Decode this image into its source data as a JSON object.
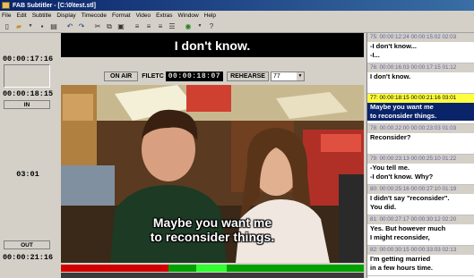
{
  "window": {
    "title": "FAB Subtitler - [C:\\0\\test.stl]"
  },
  "menu": [
    "File",
    "Edit",
    "Subtitle",
    "Display",
    "Timecode",
    "Format",
    "Video",
    "Extras",
    "Window",
    "Help"
  ],
  "left_panel": {
    "tc_in": "00:00:17:16",
    "tc_out_top": "00:00:18:15",
    "in_label": "IN",
    "duration": "03:01",
    "out_label": "OUT",
    "tc_out_bottom": "00:00:21:16"
  },
  "top_subtitle": "I don't know.",
  "controls": {
    "on_air": "ON AIR",
    "filetc_label": "FILETC",
    "filetc_value": "00:00:18:07",
    "rehearse": "REHEARSE",
    "subtitle_number": "77"
  },
  "video": {
    "subtitle_line1": "Maybe you want me",
    "subtitle_line2": "to reconsider things.",
    "progress_fraction": 0.52
  },
  "subtitle_list": [
    {
      "header": "75: 00:00:12:24  00:00:15:02  02:03",
      "lines": [
        "-I don't know...",
        "-I..."
      ],
      "selected": false
    },
    {
      "header": "76: 00:00:16:03  00:00:17:15  01:12",
      "lines": [
        "I don't know."
      ],
      "selected": false
    },
    {
      "header": "77: 00:00:18:15  00:00:21:16  03:01",
      "lines": [
        "Maybe you want me",
        "to reconsider things."
      ],
      "selected": true
    },
    {
      "header": "78: 00:00:22:00  00:00:23:03  01:03",
      "lines": [
        "Reconsider?"
      ],
      "selected": false
    },
    {
      "header": "79: 00:00:23:13  00:00:25:10  01:22",
      "lines": [
        "-You tell me.",
        "-I don't know. Why?"
      ],
      "selected": false
    },
    {
      "header": "80: 00:00:25:16  00:00:27:10  01:19",
      "lines": [
        "I didn't say \"reconsider\".",
        "You did."
      ],
      "selected": false
    },
    {
      "header": "81: 00:00:27:17  00:00:30:12  02:20",
      "lines": [
        "Yes. But however much",
        "I might reconsider,"
      ],
      "selected": false
    },
    {
      "header": "82: 00:00:30:15  00:00:33:03  02:13",
      "lines": [
        "I'm getting married",
        "in a few hours time."
      ],
      "selected": false
    }
  ],
  "colors": {
    "selected_header": "#ffff40",
    "selected_text_bg": "#0a246a",
    "progress_green": "#00a000",
    "progress_red": "#d00000"
  }
}
